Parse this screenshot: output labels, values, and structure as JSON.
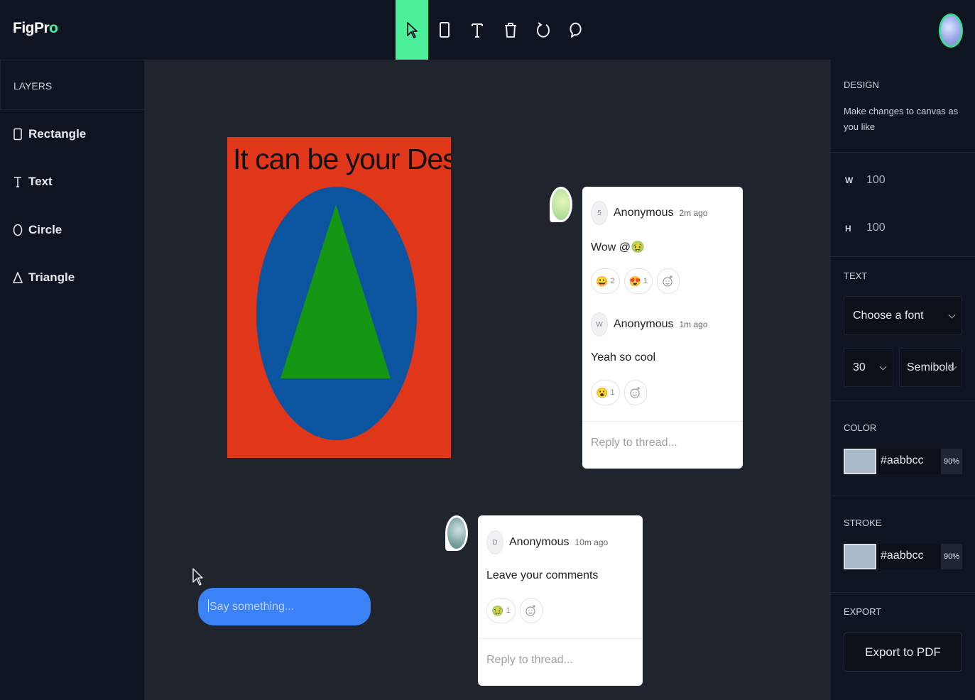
{
  "app": {
    "logo_main": "FigPr",
    "logo_accent": "o"
  },
  "toolbar": {
    "tools": [
      {
        "name": "select",
        "icon": "cursor-icon",
        "active": true
      },
      {
        "name": "rectangle",
        "icon": "rectangle-icon"
      },
      {
        "name": "text",
        "icon": "text-icon"
      },
      {
        "name": "delete",
        "icon": "trash-icon"
      },
      {
        "name": "reset",
        "icon": "reset-icon"
      },
      {
        "name": "comments",
        "icon": "comment-icon"
      }
    ],
    "active_color": "#4cf09a"
  },
  "layers": {
    "title": "LAYERS",
    "items": [
      {
        "label": "Rectangle",
        "icon": "rectangle-icon"
      },
      {
        "label": "Text",
        "icon": "text-icon"
      },
      {
        "label": "Circle",
        "icon": "circle-icon"
      },
      {
        "label": "Triangle",
        "icon": "triangle-icon"
      }
    ]
  },
  "canvas": {
    "design_text": "It can be your Design",
    "colors": {
      "rect": "#e0361a",
      "circle": "#0b54a0",
      "triangle": "#159615"
    }
  },
  "threads": [
    {
      "comments": [
        {
          "avatar": "5",
          "name": "Anonymous",
          "time": "2m ago",
          "body": "Wow @🤢",
          "reactions": [
            {
              "emoji": "😀",
              "count": "2"
            },
            {
              "emoji": "😍",
              "count": "1"
            }
          ]
        },
        {
          "avatar": "W",
          "name": "Anonymous",
          "time": "1m ago",
          "body": "Yeah so cool",
          "reactions": [
            {
              "emoji": "😮",
              "count": "1"
            }
          ]
        }
      ],
      "reply_placeholder": "Reply to thread..."
    },
    {
      "comments": [
        {
          "avatar": "D",
          "name": "Anonymous",
          "time": "10m ago",
          "body": "Leave your comments",
          "reactions": [
            {
              "emoji": "🤢",
              "count": "1"
            }
          ]
        }
      ],
      "reply_placeholder": "Reply to thread..."
    }
  ],
  "composer": {
    "placeholder": "Say something..."
  },
  "design_panel": {
    "title": "DESIGN",
    "hint": "Make changes to canvas as you like",
    "w_label": "W",
    "w_value": "100",
    "h_label": "H",
    "h_value": "100",
    "text_title": "TEXT",
    "font_placeholder": "Choose a font",
    "font_size": "30",
    "font_weight": "Semibold",
    "color_title": "COLOR",
    "fill_hex": "#aabbcc",
    "fill_opacity": "90%",
    "stroke_title": "STROKE",
    "stroke_hex": "#aabbcc",
    "stroke_opacity": "90%",
    "export_title": "EXPORT",
    "export_label": "Export to PDF"
  }
}
